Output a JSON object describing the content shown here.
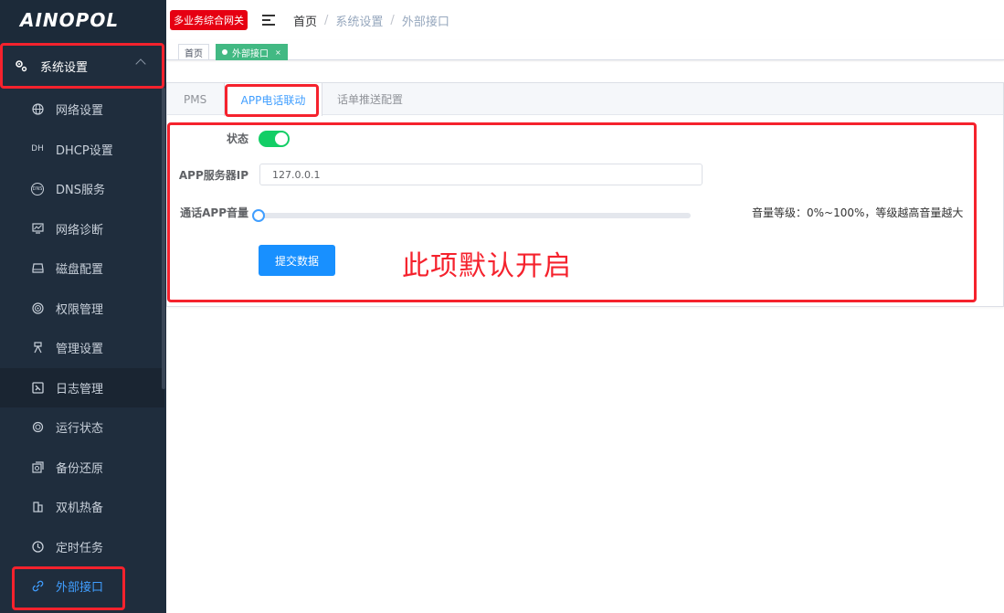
{
  "sidebar": {
    "logo": "AINOPOL",
    "parent": {
      "label": "系统设置",
      "icon": "gears-icon"
    },
    "items": [
      {
        "label": "网络设置",
        "icon": "globe-icon"
      },
      {
        "label": "DHCP设置",
        "icon": "dhcp-icon",
        "icon_text": "DH"
      },
      {
        "label": "DNS服务",
        "icon": "dns-icon",
        "icon_text": "DNS"
      },
      {
        "label": "网络诊断",
        "icon": "monitor-chart-icon"
      },
      {
        "label": "磁盘配置",
        "icon": "disk-icon"
      },
      {
        "label": "权限管理",
        "icon": "target-icon"
      },
      {
        "label": "管理设置",
        "icon": "tripod-icon"
      },
      {
        "label": "日志管理",
        "icon": "log-icon"
      },
      {
        "label": "运行状态",
        "icon": "status-icon"
      },
      {
        "label": "备份还原",
        "icon": "backup-icon"
      },
      {
        "label": "双机热备",
        "icon": "hot-standby-icon"
      },
      {
        "label": "定时任务",
        "icon": "clock-icon"
      },
      {
        "label": "外部接口",
        "icon": "link-icon"
      }
    ]
  },
  "header": {
    "badge": "多业务综合网关",
    "breadcrumb": [
      "首页",
      "系统设置",
      "外部接口"
    ],
    "separator": "/"
  },
  "tags": {
    "home": "首页",
    "current": "外部接口",
    "close": "×"
  },
  "tabs": [
    "PMS",
    "APP电话联动",
    "话单推送配置"
  ],
  "form": {
    "status_label": "状态",
    "status_on": true,
    "server_ip_label": "APP服务器IP",
    "server_ip_value": "127.0.0.1",
    "volume_label": "通话APP音量",
    "volume_percent": 0,
    "volume_hint": "音量等级：0%~100%，等级越高音量越大",
    "submit_label": "提交数据"
  },
  "annotation": "此项默认开启",
  "colors": {
    "sidebar_bg": "#1f2d3d",
    "highlight_red": "#f5222d",
    "active_blue": "#409eff",
    "switch_green": "#13ce66",
    "tag_green": "#42b983",
    "button_blue": "#1890ff"
  }
}
